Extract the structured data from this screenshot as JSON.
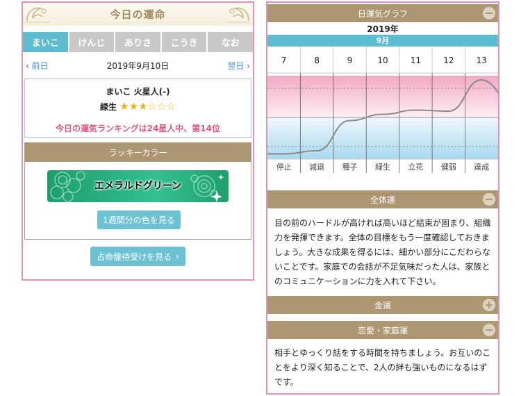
{
  "left": {
    "title": "今日の運命",
    "tabs": [
      "まいこ",
      "けんじ",
      "ありさ",
      "こうき",
      "なお"
    ],
    "active_tab": 0,
    "nav": {
      "prev": "前日",
      "date": "2019年9月10日",
      "next": "翌日"
    },
    "profile": {
      "name": "まいこ 火星人(-)",
      "type": "緑生",
      "stars_filled": 3,
      "stars_total": 6,
      "ranking": "今日の運気ランキングは24星人中、第14位"
    },
    "lucky": {
      "heading": "ラッキーカラー",
      "color_name": "エメラルドグリーン",
      "week_button": "1週間分の色を見る"
    },
    "fortune_button": "占命盤待受けを見る"
  },
  "right": {
    "graph": {
      "heading": "日運気グラフ",
      "year": "2019年",
      "month": "9月",
      "days": [
        "7",
        "8",
        "9",
        "10",
        "11",
        "12",
        "13"
      ],
      "labels": [
        "停止",
        "減退",
        "種子",
        "緑生",
        "立花",
        "健弱",
        "達成"
      ]
    },
    "sections": [
      {
        "heading": "全体運",
        "state": "−",
        "text": "目の前のハードルが高ければ高いほど結束が固まり、組織力を発揮できます。全体の目標をもう一度確認しておきましょう。大きな成果を得るには、細かい部分にこだわらないことです。家庭での会話が不足気味だった人は、家族とのコミュニケーションに力を入れて下さい。"
      },
      {
        "heading": "金運",
        "state": "+",
        "text": ""
      },
      {
        "heading": "恋愛・家庭運",
        "state": "−",
        "text": "相手とゆっくり話をする時間を持ちましょう。お互いのことをより深く知ることで、2人の絆も強いものになるはずです。"
      }
    ]
  },
  "chart_data": {
    "type": "line",
    "title": "日運気グラフ",
    "x": [
      "7",
      "8",
      "9",
      "10",
      "11",
      "12",
      "13"
    ],
    "x_labels": [
      "停止",
      "減退",
      "種子",
      "緑生",
      "立花",
      "健弱",
      "達成"
    ],
    "series": [
      {
        "values": [
          -3.5,
          -3.2,
          -0.3,
          0.3,
          0.7,
          0.6,
          3.6
        ]
      }
    ],
    "ylim": [
      -4,
      4
    ],
    "bands": {
      "positive": "#f2a8c4",
      "negative": "#a8d8f0"
    },
    "line_color": "#8a8a8a"
  },
  "colors": {
    "accent_blue": "#5ebcd1",
    "section_brown": "#ad9772",
    "border_pink": "#e58fbf",
    "rank_pink": "#e3557f"
  }
}
